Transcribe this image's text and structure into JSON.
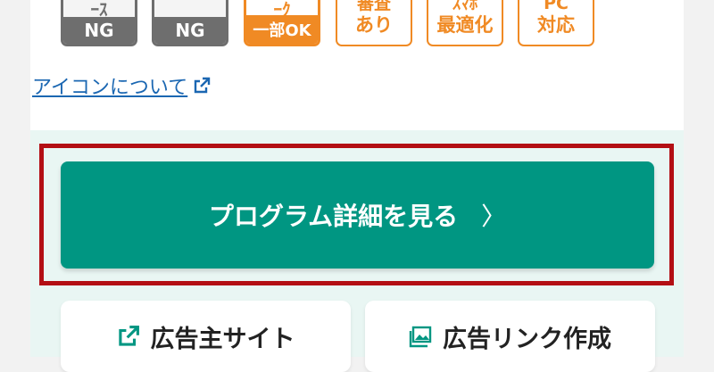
{
  "badges": [
    {
      "type": "gray",
      "top": "ｰｽ",
      "bottom": "NG"
    },
    {
      "type": "gray",
      "top": "",
      "bottom": "NG"
    },
    {
      "type": "orange",
      "top": "ｰｸ",
      "bottom": "一部OK"
    },
    {
      "type": "outline",
      "line1": "審査",
      "line2": "あり"
    },
    {
      "type": "outline",
      "line1": "ｽﾏﾎ",
      "line2": "最適化"
    },
    {
      "type": "outline",
      "line1": "PC",
      "line2": "対応"
    }
  ],
  "icons_link": {
    "label": "アイコンについて"
  },
  "detail_button": {
    "label": "プログラム詳細を見る",
    "chevron": "〉"
  },
  "sub_buttons": {
    "advertiser": {
      "label": "広告主サイト"
    },
    "ad_link": {
      "label": "広告リンク作成"
    }
  },
  "colors": {
    "teal": "#009682",
    "orange": "#f08a24",
    "gray": "#6e6e6e",
    "highlight": "#b30f14",
    "link": "#1b67b2"
  }
}
